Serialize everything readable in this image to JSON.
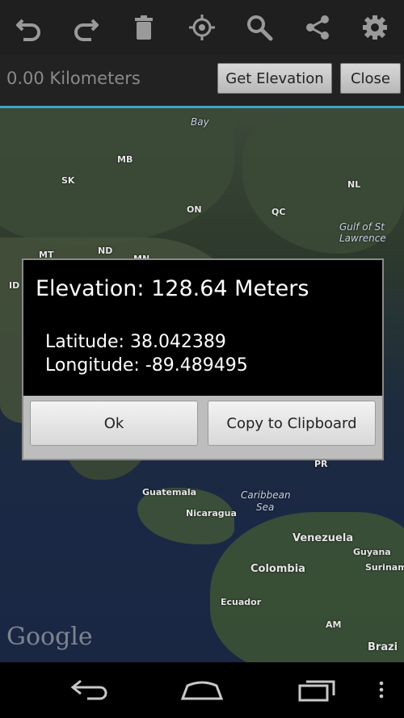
{
  "actionbar": {
    "icons": [
      "undo-icon",
      "redo-icon",
      "trash-icon",
      "locate-icon",
      "search-icon",
      "share-icon",
      "gear-icon"
    ]
  },
  "subbar": {
    "distance": "0.00 Kilometers",
    "get_elevation_label": "Get Elevation",
    "close_label": "Close"
  },
  "map": {
    "labels": {
      "bay": "Bay",
      "sk": "SK",
      "mb": "MB",
      "on": "ON",
      "qc": "QC",
      "nl": "NL",
      "gulf": "Gulf of St",
      "lawrence": "Lawrence",
      "mt": "MT",
      "nd": "ND",
      "mn": "MN",
      "id": "ID",
      "pr": "PR",
      "guatemala": "Guatemala",
      "caribbean": "Caribbean",
      "sea": "Sea",
      "nicaragua": "Nicaragua",
      "venezuela": "Venezuela",
      "guyana": "Guyana",
      "colombia": "Colombia",
      "surinam": "Surinam",
      "ecuador": "Ecuador",
      "am": "AM",
      "brazil": "Brazi"
    },
    "attribution": "Google"
  },
  "dialog": {
    "title": "Elevation: 128.64 Meters",
    "latitude": "Latitude: 38.042389",
    "longitude": "Longitude: -89.489495",
    "ok_label": "Ok",
    "copy_label": "Copy to Clipboard"
  },
  "navbar": {
    "icons": [
      "back-icon",
      "home-icon",
      "recent-apps-icon",
      "menu-icon"
    ]
  },
  "colors": {
    "accent": "#3aa6c5",
    "actionbar_bg": "#1f1f1f",
    "dialog_bg": "#000000"
  }
}
